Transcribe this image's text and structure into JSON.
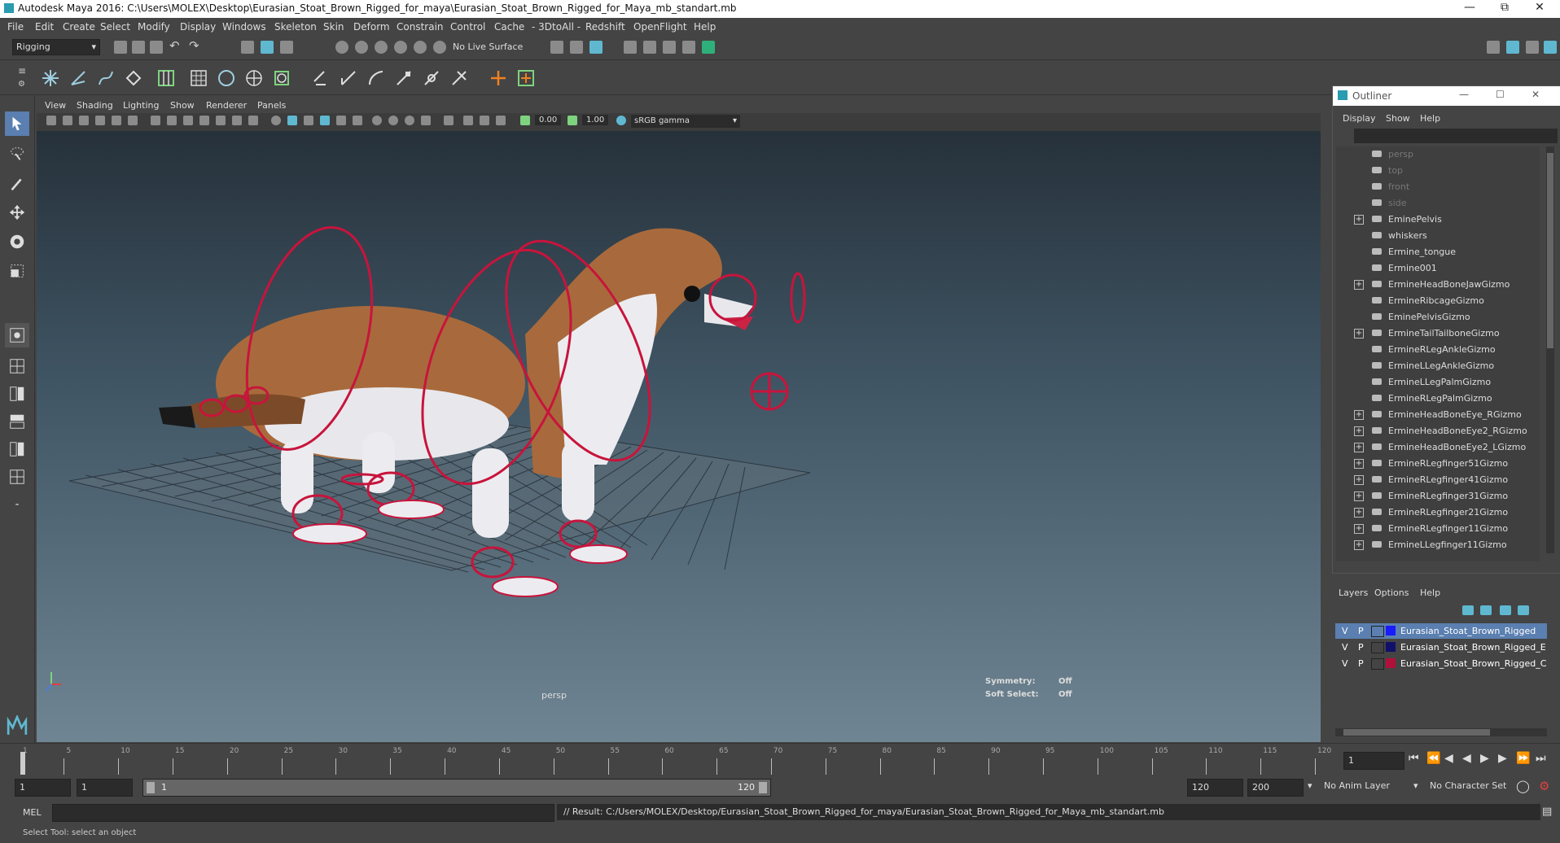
{
  "app": {
    "title": "Autodesk Maya 2016: C:\\Users\\MOLEX\\Desktop\\Eurasian_Stoat_Brown_Rigged_for_maya\\Eurasian_Stoat_Brown_Rigged_for_Maya_mb_standart.mb"
  },
  "menubar": [
    "File",
    "Edit",
    "Create",
    "Select",
    "Modify",
    "Display",
    "Windows",
    "Skeleton",
    "Skin",
    "Deform",
    "Constrain",
    "Control",
    "Cache",
    "- 3DtoAll -",
    "Redshift",
    "OpenFlight",
    "Help"
  ],
  "statusline": {
    "mode": "Rigging",
    "live_surface": "No Live Surface"
  },
  "viewport": {
    "menu": [
      "View",
      "Shading",
      "Lighting",
      "Show",
      "Renderer",
      "Panels"
    ],
    "near_value": "0.00",
    "far_value": "1.00",
    "color_space": "sRGB gamma",
    "camera_label": "persp",
    "symmetry_label": "Symmetry:",
    "symmetry_value": "Off",
    "soft_select_label": "Soft Select:",
    "soft_select_value": "Off"
  },
  "outliner": {
    "title": "Outliner",
    "menu": [
      "Display",
      "Show",
      "Help"
    ],
    "items": [
      {
        "label": "persp",
        "expand": false,
        "dim": true
      },
      {
        "label": "top",
        "expand": false,
        "dim": true
      },
      {
        "label": "front",
        "expand": false,
        "dim": true
      },
      {
        "label": "side",
        "expand": false,
        "dim": true
      },
      {
        "label": "EminePelvis",
        "expand": true,
        "dim": false
      },
      {
        "label": "whiskers",
        "expand": false,
        "dim": false
      },
      {
        "label": "Ermine_tongue",
        "expand": false,
        "dim": false
      },
      {
        "label": "Ermine001",
        "expand": false,
        "dim": false
      },
      {
        "label": "ErmineHeadBoneJawGizmo",
        "expand": true,
        "dim": false
      },
      {
        "label": "ErmineRibcageGizmo",
        "expand": false,
        "dim": false
      },
      {
        "label": "EminePelvisGizmo",
        "expand": false,
        "dim": false
      },
      {
        "label": "ErmineTailTailboneGizmo",
        "expand": true,
        "dim": false
      },
      {
        "label": "ErmineRLegAnkleGizmo",
        "expand": false,
        "dim": false
      },
      {
        "label": "ErmineLLegAnkleGizmo",
        "expand": false,
        "dim": false
      },
      {
        "label": "ErmineLLegPalmGizmo",
        "expand": false,
        "dim": false
      },
      {
        "label": "ErmineRLegPalmGizmo",
        "expand": false,
        "dim": false
      },
      {
        "label": "ErmineHeadBoneEye_RGizmo",
        "expand": true,
        "dim": false
      },
      {
        "label": "ErmineHeadBoneEye2_RGizmo",
        "expand": true,
        "dim": false
      },
      {
        "label": "ErmineHeadBoneEye2_LGizmo",
        "expand": true,
        "dim": false
      },
      {
        "label": "ErmineRLegfinger51Gizmo",
        "expand": true,
        "dim": false
      },
      {
        "label": "ErmineRLegfinger41Gizmo",
        "expand": true,
        "dim": false
      },
      {
        "label": "ErmineRLegfinger31Gizmo",
        "expand": true,
        "dim": false
      },
      {
        "label": "ErmineRLegfinger21Gizmo",
        "expand": true,
        "dim": false
      },
      {
        "label": "ErmineRLegfinger11Gizmo",
        "expand": true,
        "dim": false
      },
      {
        "label": "ErmineLLegfinger11Gizmo",
        "expand": true,
        "dim": false
      }
    ]
  },
  "layers": {
    "menu": [
      "Layers",
      "Options",
      "Help"
    ],
    "rows": [
      {
        "v": "V",
        "p": "P",
        "color": "#1a1aff",
        "name": "Eurasian_Stoat_Brown_Rigged",
        "selected": true
      },
      {
        "v": "V",
        "p": "P",
        "color": "#10106a",
        "name": "Eurasian_Stoat_Brown_Rigged_E",
        "selected": false
      },
      {
        "v": "V",
        "p": "P",
        "color": "#b0103a",
        "name": "Eurasian_Stoat_Brown_Rigged_C",
        "selected": false
      }
    ]
  },
  "timeline": {
    "ticks": [
      "1",
      "5",
      "10",
      "15",
      "20",
      "25",
      "30",
      "35",
      "40",
      "45",
      "50",
      "55",
      "60",
      "65",
      "70",
      "75",
      "80",
      "85",
      "90",
      "95",
      "100",
      "105",
      "110",
      "115",
      "120"
    ],
    "current_frame": "1"
  },
  "range": {
    "start": "1",
    "start2": "1",
    "slider_start": "1",
    "slider_end": "120",
    "end": "120",
    "end2": "200",
    "anim_layer": "No Anim Layer",
    "char_set": "No Character Set"
  },
  "command": {
    "lang": "MEL",
    "result": "// Result: C:/Users/MOLEX/Desktop/Eurasian_Stoat_Brown_Rigged_for_maya/Eurasian_Stoat_Brown_Rigged_for_Maya_mb_standart.mb"
  },
  "helpline": "Select Tool: select an object",
  "colors": {
    "accent": "#5fb8d0",
    "rig_red": "#c8143c",
    "selected_layer": "#5a7fb0"
  }
}
